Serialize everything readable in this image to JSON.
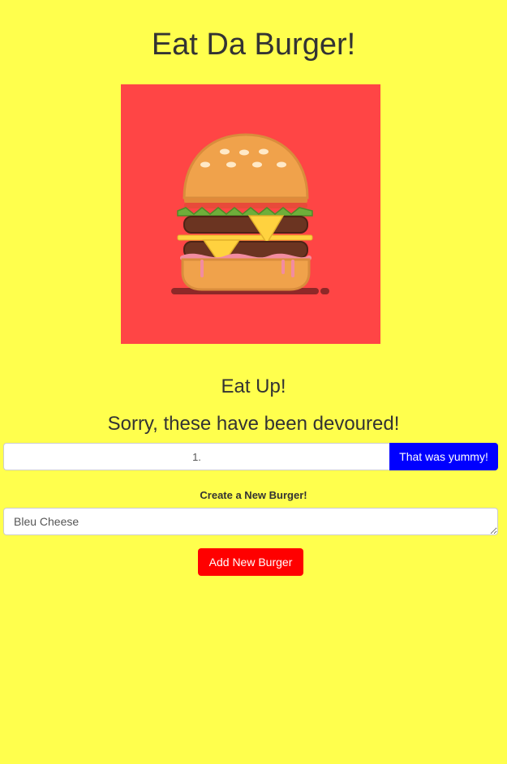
{
  "header": {
    "title": "Eat Da Burger!"
  },
  "hero": {
    "icon": "burger-illustration-icon",
    "background_color": "#ff4545"
  },
  "eat_section": {
    "heading": "Eat Up!"
  },
  "devoured_section": {
    "heading": "Sorry, these have been devoured!",
    "items": [
      {
        "label": "1.",
        "button_label": "That was yummy!"
      }
    ]
  },
  "form": {
    "label": "Create a New Burger!",
    "input_value": "Bleu Cheese",
    "submit_label": "Add New Burger"
  },
  "colors": {
    "page_background": "#ffff4d",
    "yummy_button": "#0000ff",
    "add_button": "#ff0000",
    "text": "#333333"
  }
}
